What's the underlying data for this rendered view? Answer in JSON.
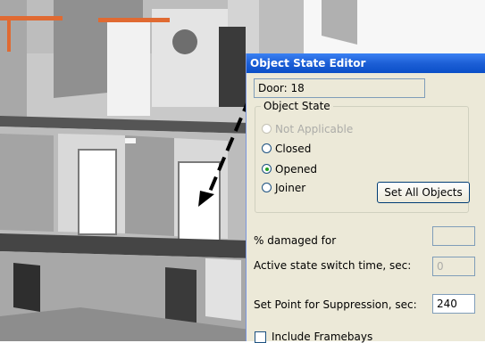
{
  "dialog": {
    "title": "Object State Editor",
    "object_name": "Door: 18",
    "object_state": {
      "legend": "Object State",
      "options": [
        {
          "label": "Not Applicable",
          "selected": false,
          "enabled": false
        },
        {
          "label": "Closed",
          "selected": false,
          "enabled": true
        },
        {
          "label": "Opened",
          "selected": true,
          "enabled": true
        },
        {
          "label": "Joiner",
          "selected": false,
          "enabled": true
        }
      ],
      "set_all_label": "Set All Objects"
    },
    "damaged_label": "% damaged for",
    "damaged_value": "",
    "switch_time_label": "Active state switch time, sec:",
    "switch_time_value": "0",
    "suppression_label": "Set Point for Suppression, sec:",
    "suppression_value": "240",
    "include_framebays_label": "Include Framebays",
    "include_framebays_checked": false
  },
  "colors": {
    "titlebar": "#0a4fc8",
    "dialog_bg": "#ece9d8",
    "radio_selected": "#21a121"
  }
}
